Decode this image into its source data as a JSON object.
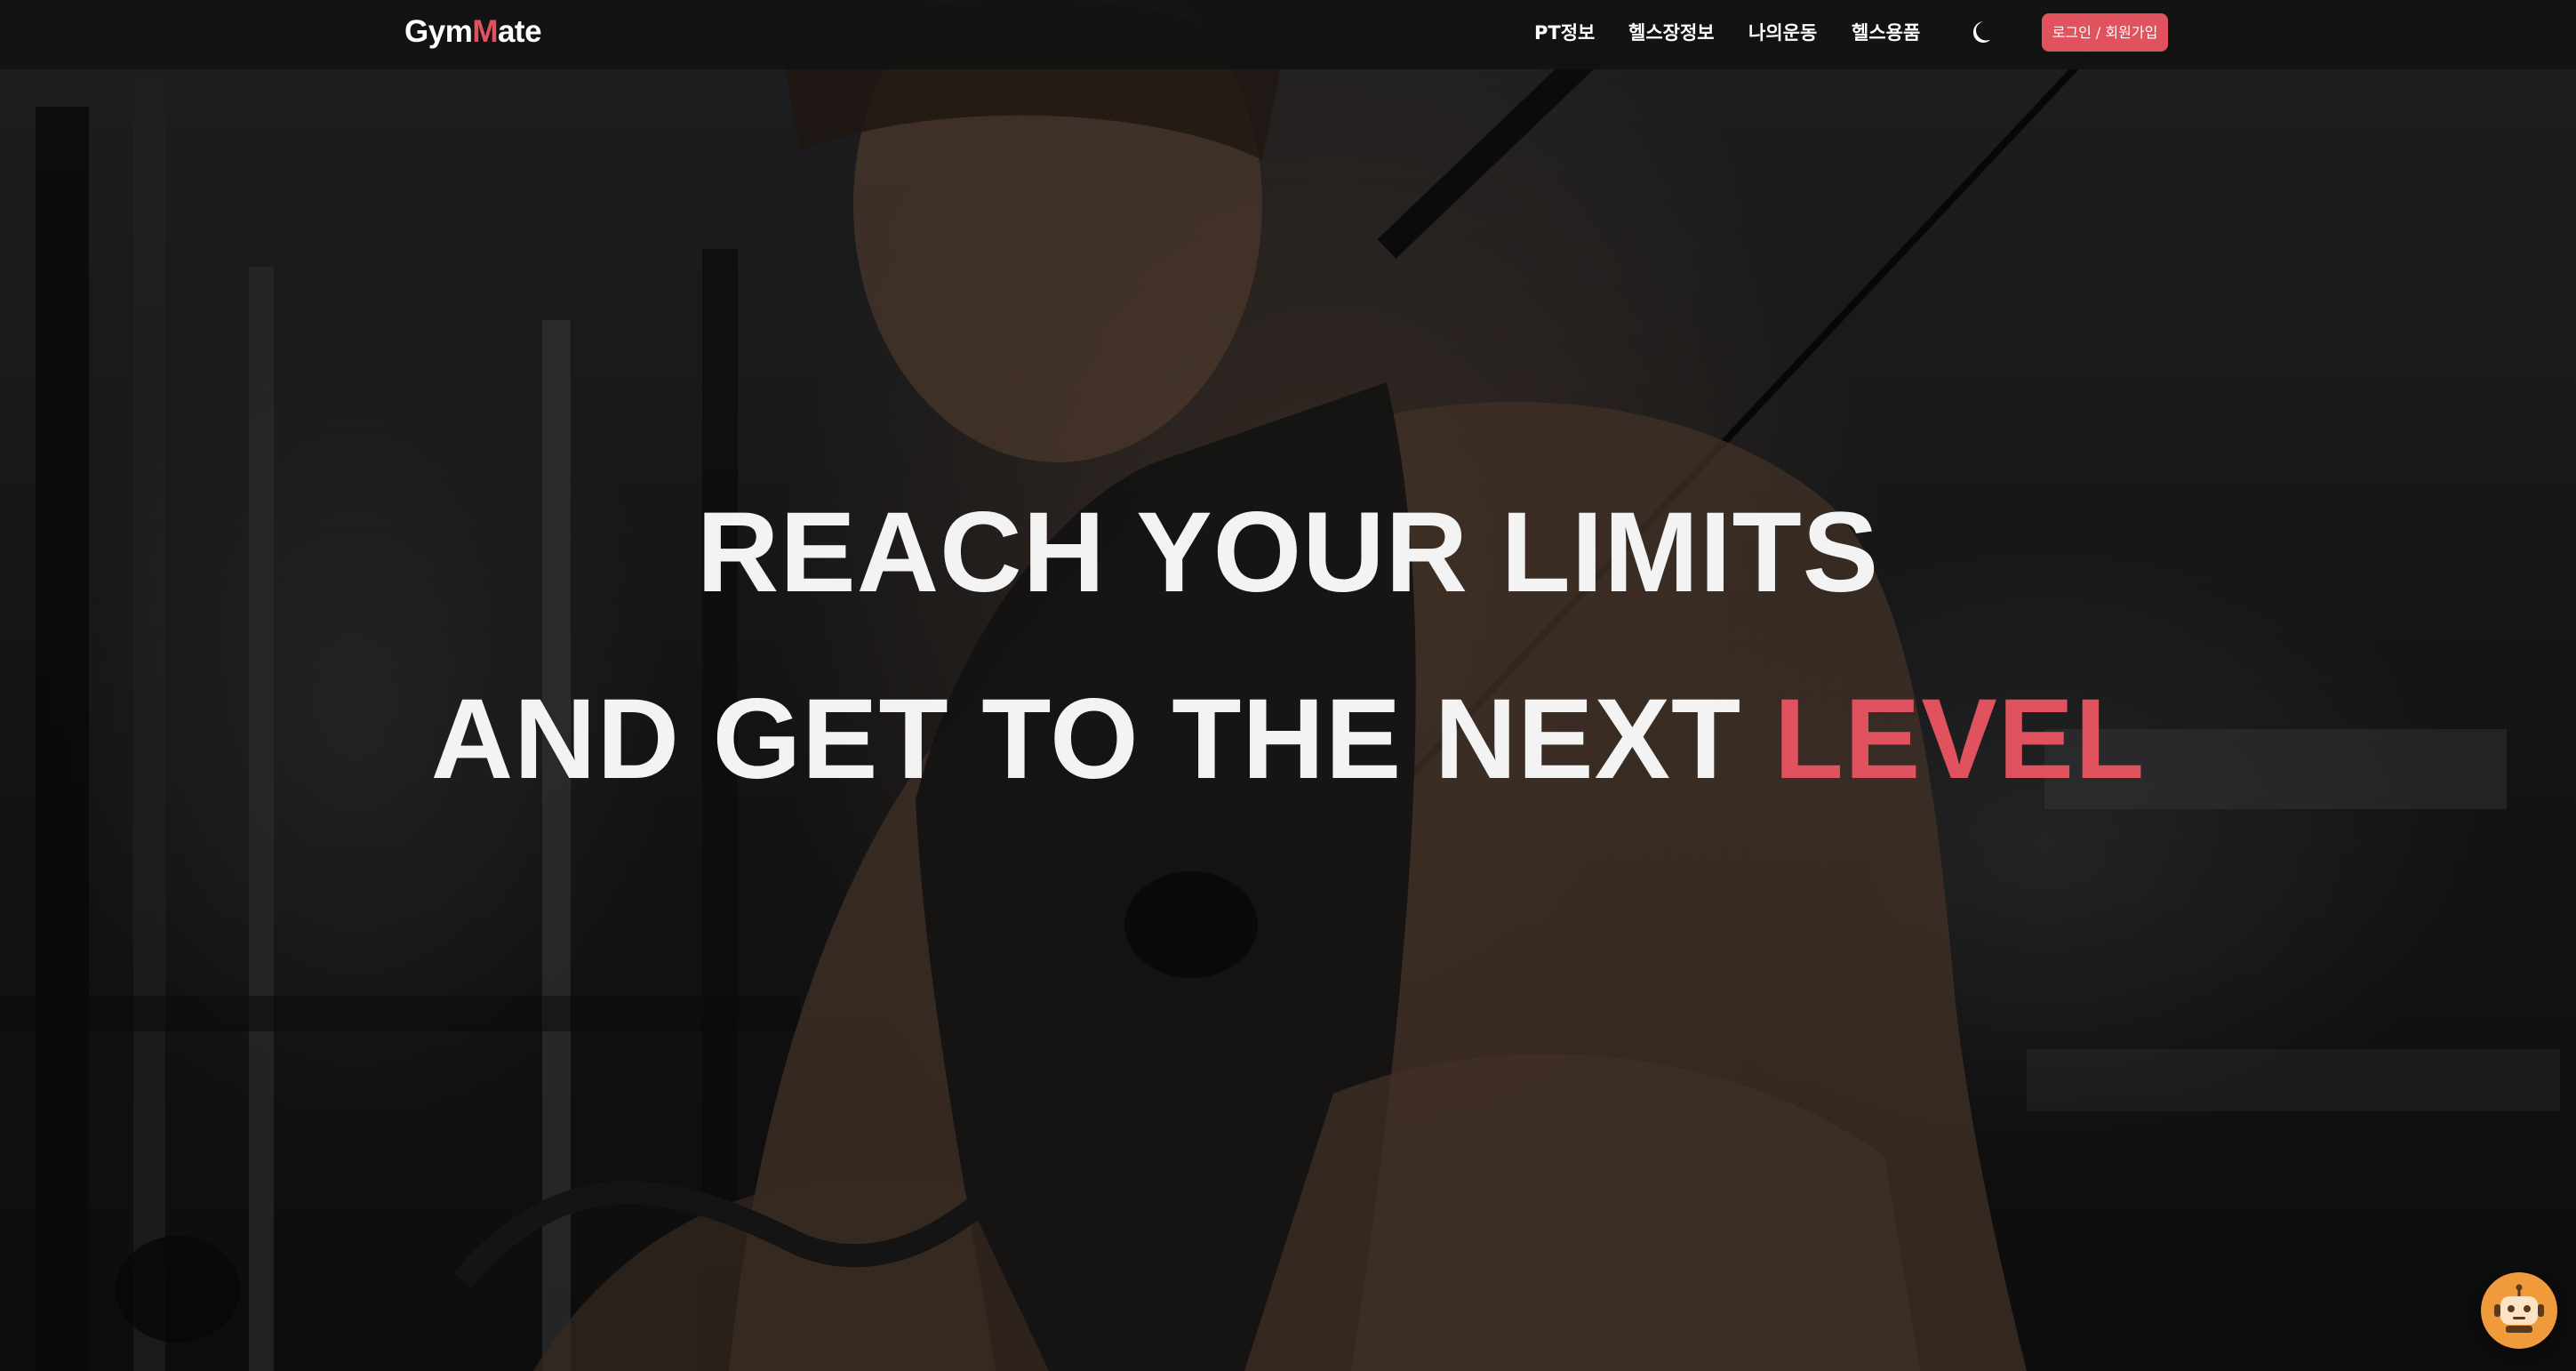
{
  "brand": {
    "logo_prefix": "Gym",
    "logo_accent": "M",
    "logo_suffix": "ate",
    "accent_color": "#e0525e"
  },
  "nav": {
    "items": [
      {
        "label": "PT정보"
      },
      {
        "label": "헬스장정보"
      },
      {
        "label": "나의운동"
      },
      {
        "label": "헬스용품"
      }
    ],
    "theme_toggle_icon": "moon-icon",
    "login_label": "로그인 / 회원가입"
  },
  "hero": {
    "line1": "REACH YOUR LIMITS",
    "line2_main": "AND GET TO THE NEXT ",
    "line2_accent": "LEVEL",
    "background_image": "muscular man training on cable machine in dark gym"
  },
  "chat": {
    "icon": "robot-icon",
    "color": "#ef9a3b"
  }
}
